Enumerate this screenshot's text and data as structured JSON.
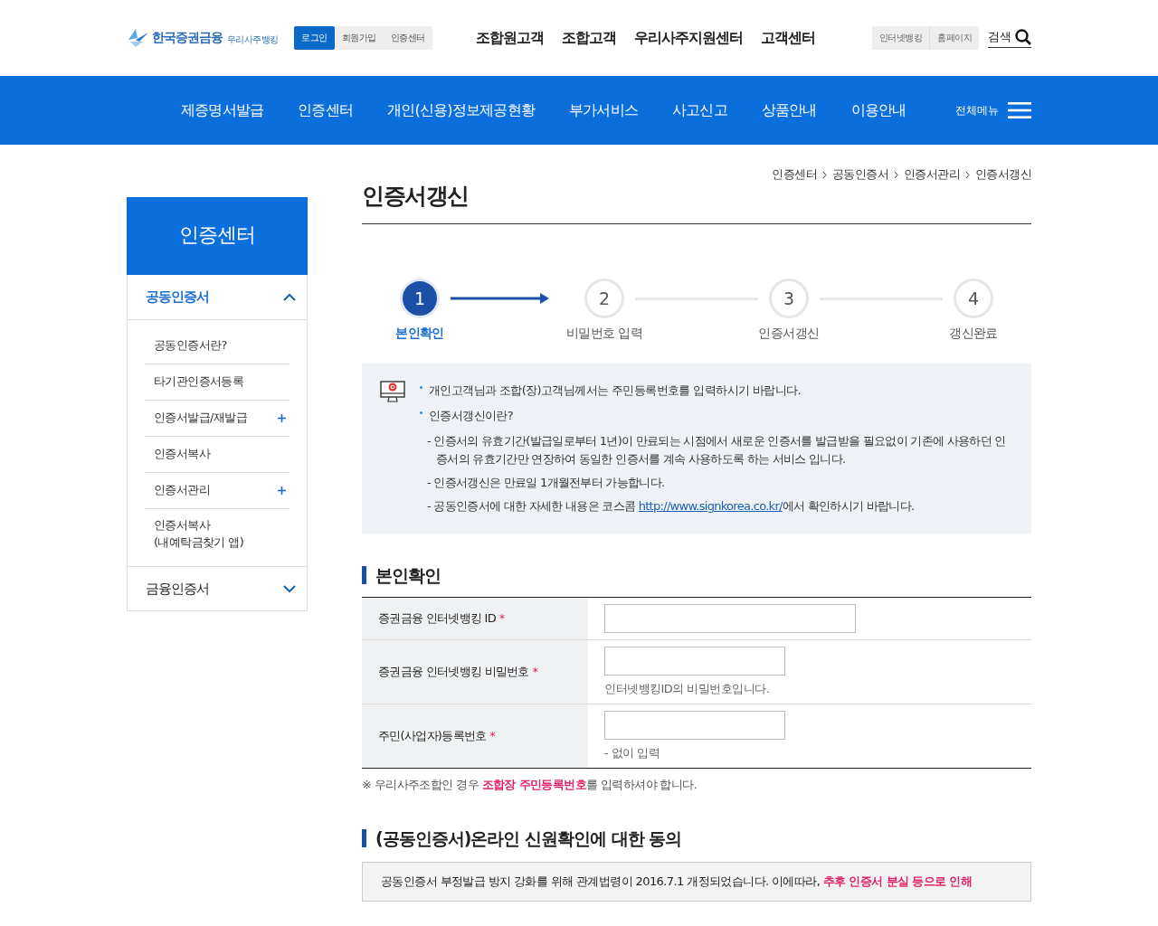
{
  "header": {
    "logo_text": "한국증권금융",
    "logo_sub": "우리사주뱅킹",
    "util_links": [
      {
        "label": "로그인",
        "selected": true
      },
      {
        "label": "회원가입",
        "selected": false
      },
      {
        "label": "인증센터",
        "selected": false
      }
    ],
    "top_menu": [
      "조합원고객",
      "조합고객",
      "우리사주지원센터",
      "고객센터"
    ],
    "side_links": [
      "인터넷뱅킹",
      "홈페이지"
    ],
    "search_label": "검색"
  },
  "gnb": {
    "items": [
      "제증명서발급",
      "인증센터",
      "개인(신용)정보제공현황",
      "부가서비스",
      "사고신고",
      "상품안내",
      "이용안내"
    ],
    "all_menu": "전체메뉴"
  },
  "breadcrumb": [
    "인증센터",
    "공동인증서",
    "인증서관리",
    "인증서갱신"
  ],
  "sidebar": {
    "title": "인증센터",
    "sections": [
      {
        "label": "공동인증서",
        "expanded": true,
        "children": [
          {
            "label": "공동인증서란?",
            "has_sub": false
          },
          {
            "label": "타기관인증서등록",
            "has_sub": false
          },
          {
            "label": "인증서발급/재발급",
            "has_sub": true
          },
          {
            "label": "인증서복사",
            "has_sub": false
          },
          {
            "label": "인증서관리",
            "has_sub": true
          },
          {
            "label": "인증서복사\n(내예탁금찾기 앱)",
            "has_sub": false
          }
        ]
      },
      {
        "label": "금융인증서",
        "expanded": false
      }
    ]
  },
  "page_title": "인증서갱신",
  "steps": [
    {
      "number": "1",
      "label": "본인확인",
      "selected": true
    },
    {
      "number": "2",
      "label": "비밀번호 입력",
      "selected": false
    },
    {
      "number": "3",
      "label": "인증서갱신",
      "selected": false
    },
    {
      "number": "4",
      "label": "갱신완료",
      "selected": false
    }
  ],
  "notice": {
    "bullets": [
      "개인고객님과 조합(장)고객님께서는 주민등록번호를 입력하시기 바랍니다.",
      "인증서갱신이란?"
    ],
    "details": [
      "- 인증서의 유효기간(발급일로부터 1년)이 만료되는 시점에서 새로운 인증서를 발급받을 필요없이 기존에 사용하던 인증서의 유효기간만 연장하여 동일한 인증서를 계속 사용하도록 하는 서비스 입니다.",
      "- 인증서갱신은 만료일 1개월전부터 가능합니다."
    ],
    "last_before": "- 공동인증서에 대한 자세한 내용은 코스콤 ",
    "link": "http://www.signkorea.co.kr/",
    "last_after": "에서 확인하시기 바랍니다."
  },
  "identity": {
    "title": "본인확인",
    "rows": [
      {
        "label": "증권금융 인터넷뱅킹 ID",
        "required_mark": "*",
        "wide": true
      },
      {
        "label": "증권금융 인터넷뱅킹 비밀번호",
        "required_mark": "*",
        "wide": false,
        "hint": "인터넷뱅킹ID의 비밀번호입니다."
      },
      {
        "label": "주민(사업자)등록번호",
        "required_mark": "*",
        "wide": false,
        "hint": "- 없이 입력"
      }
    ],
    "note_before": "※ 우리사주조합인 경우 ",
    "note_strong": "조합장 주민등록번호",
    "note_after": "를 입력하셔야 합니다."
  },
  "consent": {
    "title": "(공동인증서)온라인 신원확인에 대한 동의",
    "text_before": "공동인증서 부정발급 방지 강화를 위해 관계법령이 2016.7.1 개정되었습니다. 이에따라, ",
    "text_strong": "추후 인증서 분실 등으로 인해"
  }
}
